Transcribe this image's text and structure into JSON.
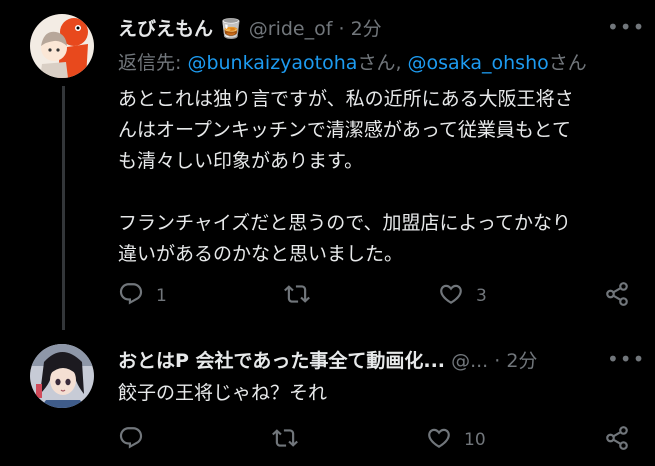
{
  "tweet1": {
    "display_name": "えびえもん",
    "emoji": "🥃",
    "handle": "@ride_of",
    "separator": "·",
    "time": "2分",
    "reply_prefix": "返信先: ",
    "mention1": "@bunkaizyaotoha",
    "suffix1": "さん, ",
    "mention2": "@osaka_ohsho",
    "suffix2": "さん",
    "text_lines": [
      "あとこれは独り言ですが、私の近所にある大阪王将さ",
      "んはオープンキッチンで清潔感があって従業員もとて",
      "も清々しい印象があります。"
    ],
    "text_lines2": [
      "フランチャイズだと思うので、加盟店によってかなり",
      "違いがあるのかなと思いました。"
    ],
    "reply_count": "1",
    "retweet_count": "",
    "like_count": "3"
  },
  "tweet2": {
    "display_name": "おとはP 会社であった事全て動画化...",
    "handle": "@...",
    "separator": "·",
    "time": "2分",
    "text": "餃子の王将じゃね？それ",
    "reply_count": "",
    "retweet_count": "",
    "like_count": "10"
  },
  "colors": {
    "background": "#000000",
    "text": "#e7e9ea",
    "secondary": "#71767b",
    "link": "#1d9bf0",
    "thread_line": "#333639"
  },
  "icons": [
    "reply-icon",
    "retweet-icon",
    "like-icon",
    "share-icon",
    "more-icon"
  ]
}
